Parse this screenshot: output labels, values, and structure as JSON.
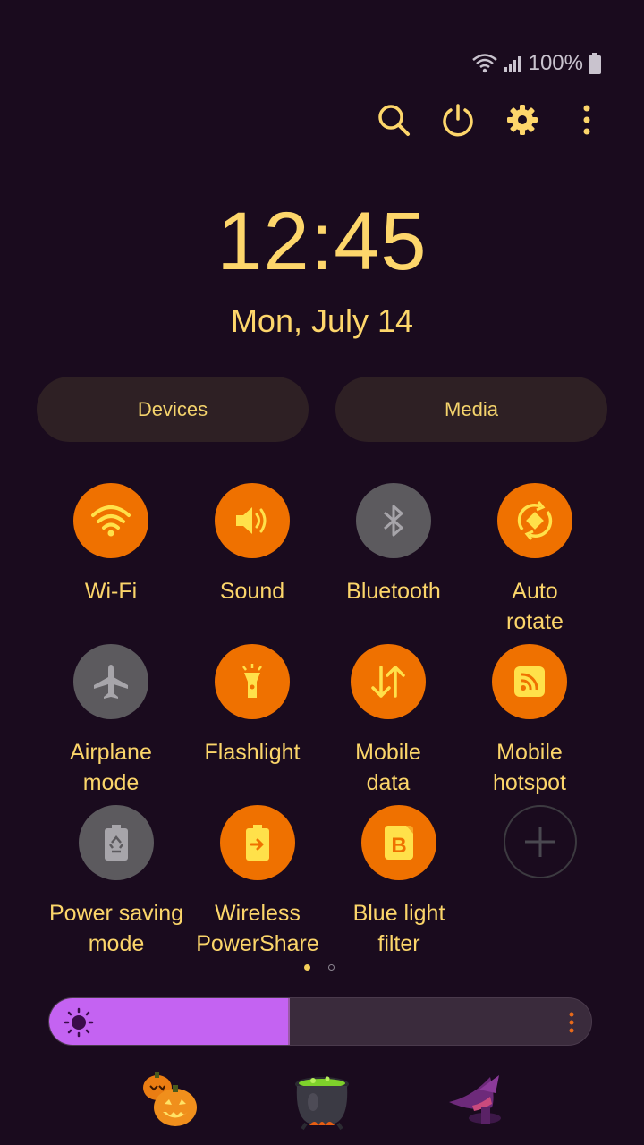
{
  "status_bar": {
    "battery_text": "100%"
  },
  "clock": {
    "time": "12:45",
    "date": "Mon, July 14"
  },
  "panels": {
    "devices": "Devices",
    "media": "Media"
  },
  "tiles": [
    {
      "label": "Wi-Fi",
      "icon": "wifi-icon",
      "state": "on"
    },
    {
      "label": "Sound",
      "icon": "sound-icon",
      "state": "on"
    },
    {
      "label": "Bluetooth",
      "icon": "bluetooth-icon",
      "state": "off"
    },
    {
      "label": "Auto\nrotate",
      "icon": "auto-rotate-icon",
      "state": "on"
    },
    {
      "label": "Airplane\nmode",
      "icon": "airplane-icon",
      "state": "off"
    },
    {
      "label": "Flashlight",
      "icon": "flashlight-icon",
      "state": "on"
    },
    {
      "label": "Mobile\ndata",
      "icon": "mobile-data-icon",
      "state": "on"
    },
    {
      "label": "Mobile\nhotspot",
      "icon": "hotspot-icon",
      "state": "on"
    },
    {
      "label": "Power saving\nmode",
      "icon": "power-saving-icon",
      "state": "off"
    },
    {
      "label": "Wireless\nPowerShare",
      "icon": "powershare-icon",
      "state": "on"
    },
    {
      "label": "Blue light\nfilter",
      "icon": "blue-light-icon",
      "state": "on"
    }
  ],
  "page_indicator": {
    "current": 1,
    "total": 2
  },
  "brightness": {
    "level": 0.44
  },
  "colors": {
    "accent": "#ef7100",
    "text": "#fdd66b",
    "background": "#1a0b1e",
    "slider": "#c463f2"
  }
}
